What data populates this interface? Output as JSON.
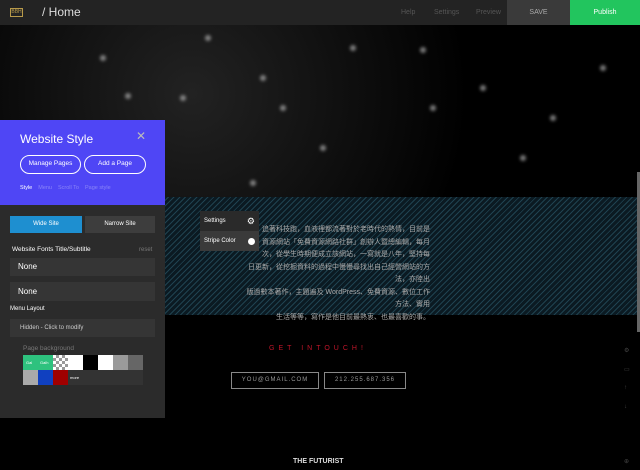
{
  "topbar": {
    "logo": "BBH",
    "breadcrumb": "/ Home",
    "help": "Help",
    "settings": "Settings",
    "preview": "Preview",
    "save": "SAVE",
    "publish": "Publish",
    "publish_color": "#22c55e"
  },
  "panel": {
    "title": "Website Style",
    "manage_pages": "Manage Pages",
    "add_page": "Add a Page",
    "tabs": [
      "Style",
      "Menu",
      "Scroll To",
      "Page style"
    ],
    "wide_site": "Wide Site",
    "narrow_site": "Narrow Site",
    "fonts_label": "Website Fonts Title/Subtitle",
    "reset": "reset",
    "font_title": "None",
    "font_subtitle": "None",
    "menu_layout_label": "Menu Layout",
    "menu_layout_value": "Hidden - Click to modify",
    "page_background_label": "Page background",
    "swatch_labels": [
      "Gal",
      "Galh",
      "more"
    ],
    "swatches": [
      "#2ec27e",
      "#2ec27e",
      "checker",
      "#ffffff",
      "#000000",
      "#ffffff",
      "#9a9a9a",
      "#666666",
      "#aaaaaa",
      "#1040c0",
      "#a00000",
      "#333333"
    ],
    "accent": "#4f46f5"
  },
  "popup": {
    "settings": "Settings",
    "stripe_color": "Stripe Color"
  },
  "content": {
    "bio": [
      "追著科技跑，血液裡都流著對於老時代的熱情，目前是",
      "資源網站「免費資源網路社群」創辦人暨總編輯，每月",
      "次，從學生時期便成立該網站，一寫就是八年，堅持每",
      "日更新，從挖掘資料的過程中慢慢尋找出自己經營網站的方法，亦陸出",
      "版過數本著作，主題遍及 WordPress、免費資源、數位工作方法、實用",
      "生活等等，寫作是他目前最熱衷、也最喜歡的事。"
    ],
    "get_in_touch": "GET INTOUCH!",
    "email": "YOU@GMAIL.COM",
    "phone": "212.255.687.356",
    "footer": "THE FUTURIST"
  }
}
